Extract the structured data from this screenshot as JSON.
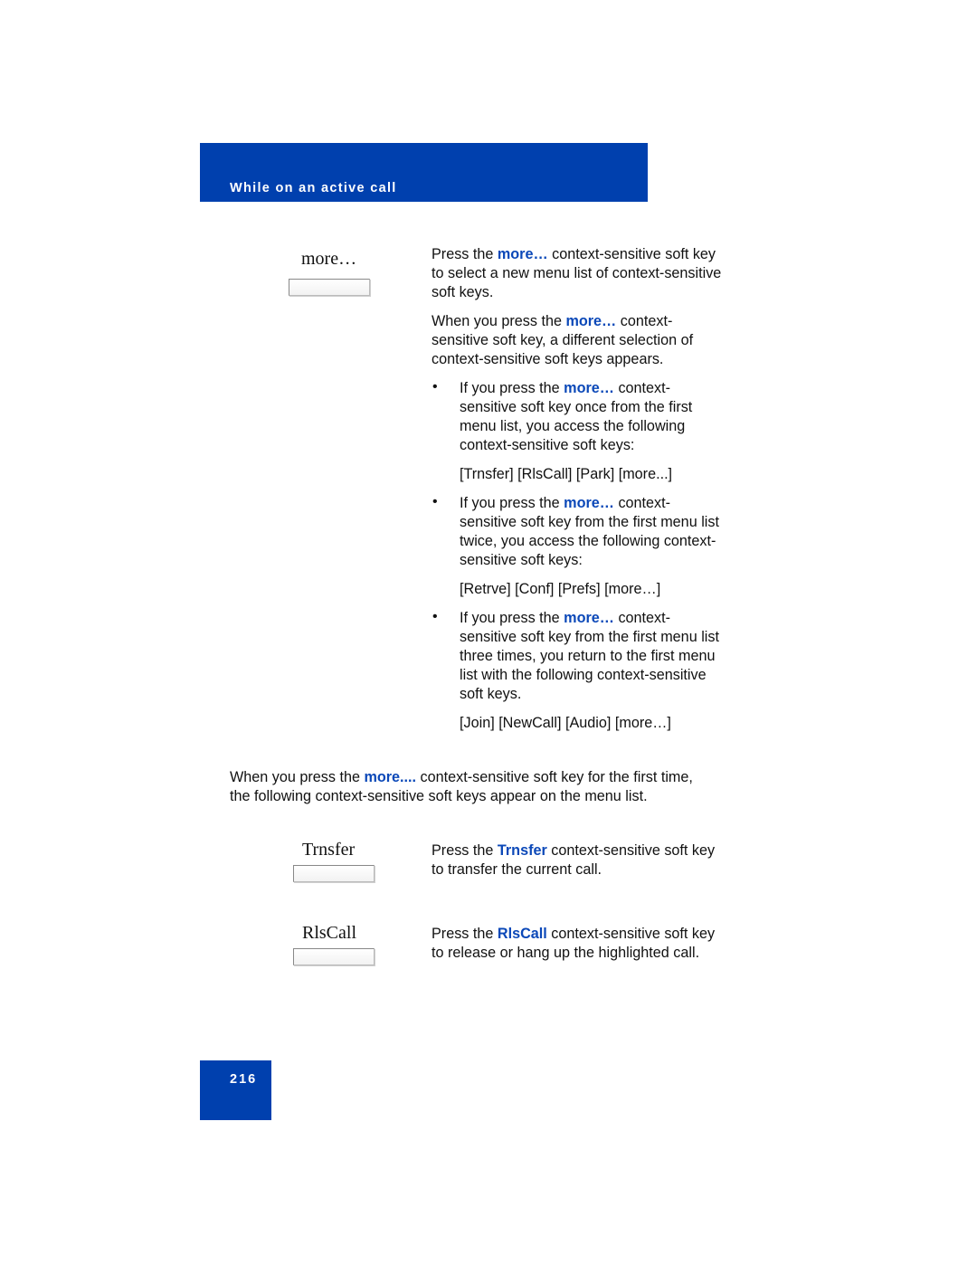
{
  "header": {
    "title": "While on an active call",
    "color": "#0040ae"
  },
  "highlight_color": "#0b48b8",
  "sections": {
    "more": {
      "key_label": "more…",
      "p1": {
        "pre": "Press the ",
        "hl": "more…",
        "post_l1": " context-sensitive soft key",
        "l2": "to select a new menu list of context-sensitive",
        "l3": "soft keys."
      },
      "p2": {
        "pre": "When you press the ",
        "hl": "more…",
        "post_l1": " context-",
        "l2": "sensitive soft key, a different selection of",
        "l3": "context-sensitive soft keys appears."
      },
      "bullets": [
        {
          "symbol": "•",
          "pre": "If you press the ",
          "hl": "more…",
          "post_l1": " context-",
          "lines": [
            "sensitive soft key once from the first",
            "menu list, you access the following",
            "context-sensitive soft keys:"
          ],
          "keys": "[Trnsfer] [RlsCall] [Park] [more...]"
        },
        {
          "symbol": "•",
          "pre": "If you press the ",
          "hl": "more…",
          "post_l1": " context-",
          "lines": [
            "sensitive soft key from the first menu list",
            "twice, you access the following context-",
            "sensitive soft keys:"
          ],
          "keys": "[Retrve] [Conf] [Prefs] [more…]"
        },
        {
          "symbol": "•",
          "pre": "If you press the ",
          "hl": "more…",
          "post_l1": " context-",
          "lines": [
            "sensitive soft key from the first menu list",
            "three times, you return to the first menu",
            "list with the following context-sensitive",
            "soft keys."
          ],
          "keys": "[Join] [NewCall] [Audio] [more…]"
        }
      ]
    },
    "intro": {
      "pre": "When you press the ",
      "hl": "more....",
      "post_l1": " context-sensitive soft key for the first time,",
      "l2": "the following context-sensitive soft keys appear on the menu list."
    },
    "trnsfer": {
      "key_label": "Trnsfer",
      "pre": "Press the ",
      "hl": "Trnsfer",
      "post_l1": " context-sensitive soft key",
      "l2": "to transfer the current call."
    },
    "rlscall": {
      "key_label": "RlsCall",
      "pre": "Press the ",
      "hl": "RlsCall",
      "post_l1": " context-sensitive soft key",
      "l2": "to release or hang up the highlighted call."
    }
  },
  "page_number": "216"
}
